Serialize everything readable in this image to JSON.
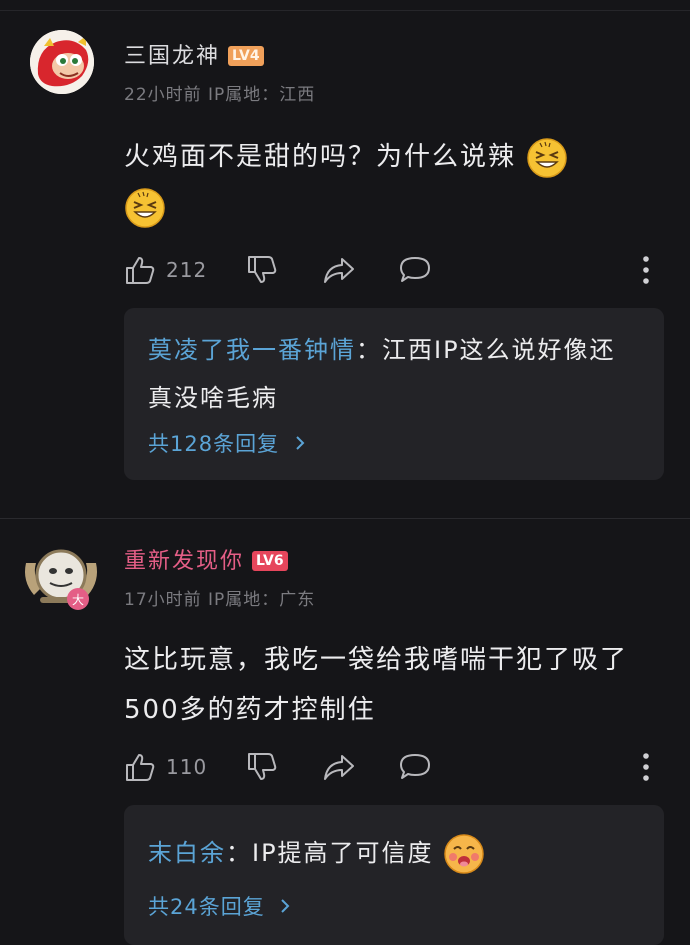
{
  "comments": [
    {
      "username": "三国龙神",
      "level": "LV4",
      "meta": "22小时前 IP属地：江西",
      "text": "火鸡面不是甜的吗？为什么说辣",
      "likes": "212",
      "reply": {
        "user": "莫凌了我一番钟情",
        "text": "：江西IP这么说好像还真没啥毛病",
        "more": "共128条回复"
      }
    },
    {
      "username": "重新发现你",
      "level": "LV6",
      "avatar_badge": "大",
      "meta": "17小时前 IP属地：广东",
      "text": "这比玩意，我吃一袋给我嗜喘干犯了吸了500多的药才控制住",
      "likes": "110",
      "reply": {
        "user": "末白余",
        "text": "：IP提高了可信度",
        "more": "共24条回复"
      }
    }
  ],
  "icons": {
    "like": "thumbs-up-icon",
    "dislike": "thumbs-down-icon",
    "share": "share-icon",
    "comment": "chat-bubble-icon",
    "more": "vertical-dots-icon",
    "chevron": "chevron-right-icon"
  },
  "colors": {
    "background": "#151518",
    "reply_box": "#232327",
    "link_blue": "#5ba4d6",
    "vip_pink": "#e45e86",
    "lv4": "#f0a05a",
    "lv6": "#e6465c"
  }
}
